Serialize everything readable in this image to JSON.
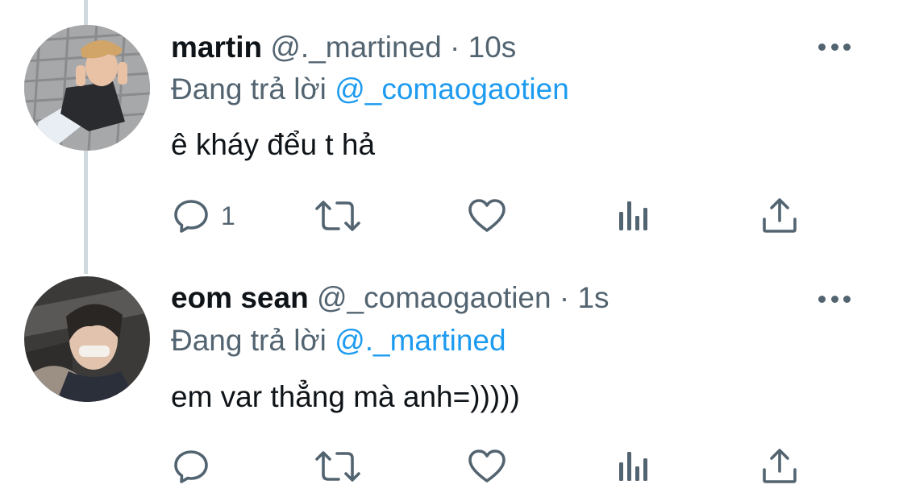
{
  "tweets": [
    {
      "display_name": "martin",
      "handle": "@._martined",
      "separator": "·",
      "time": "10s",
      "reply_prefix": "Đang trả lời",
      "reply_to": "@_comaogaotien",
      "text": "ê kháy đểu t hả",
      "reply_count": "1",
      "avatar_icon": "profile-photo-martin"
    },
    {
      "display_name": "eom sean",
      "handle": "@_comaogaotien",
      "separator": "·",
      "time": "1s",
      "reply_prefix": "Đang trả lời",
      "reply_to": "@._martined",
      "text": "em var thẳng mà anh=)))))",
      "reply_count": "",
      "avatar_icon": "profile-photo-eom-sean"
    }
  ],
  "icons": {
    "reply": "speech-bubble-icon",
    "retweet": "retweet-arrows-icon",
    "like": "heart-icon",
    "views": "bar-chart-icon",
    "share": "share-upload-icon",
    "more": "more-dots-icon"
  },
  "colors": {
    "text": "#0f1419",
    "secondary": "#536471",
    "link": "#1d9bf0",
    "thread_line": "#cfd9de"
  }
}
